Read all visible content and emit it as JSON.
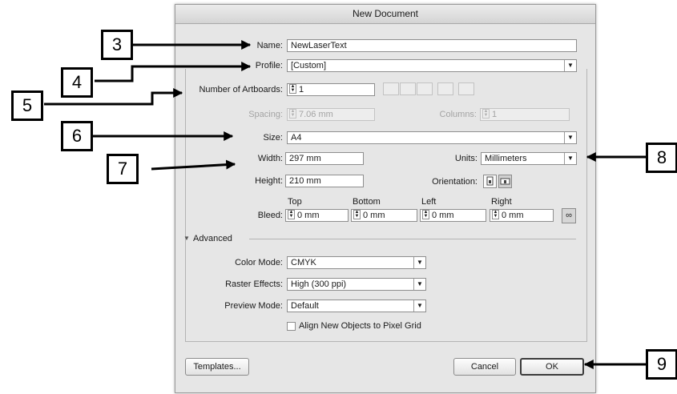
{
  "dialog": {
    "title": "New Document",
    "name": {
      "label": "Name:",
      "value": "NewLaserText"
    },
    "profile": {
      "label": "Profile:",
      "value": "[Custom]"
    },
    "artboards": {
      "label": "Number of Artboards:",
      "value": "1"
    },
    "spacing": {
      "label": "Spacing:",
      "value": "7.06 mm"
    },
    "columns": {
      "label": "Columns:",
      "value": "1"
    },
    "size": {
      "label": "Size:",
      "value": "A4"
    },
    "width": {
      "label": "Width:",
      "value": "297 mm"
    },
    "height": {
      "label": "Height:",
      "value": "210 mm"
    },
    "units": {
      "label": "Units:",
      "value": "Millimeters"
    },
    "orientation": {
      "label": "Orientation:",
      "selected": "landscape"
    },
    "bleed": {
      "label": "Bleed:",
      "top": {
        "label": "Top",
        "value": "0 mm"
      },
      "bottom": {
        "label": "Bottom",
        "value": "0 mm"
      },
      "left": {
        "label": "Left",
        "value": "0 mm"
      },
      "right": {
        "label": "Right",
        "value": "0 mm"
      }
    },
    "advanced": {
      "label": "Advanced",
      "color_mode": {
        "label": "Color Mode:",
        "value": "CMYK"
      },
      "raster_effects": {
        "label": "Raster Effects:",
        "value": "High (300 ppi)"
      },
      "preview_mode": {
        "label": "Preview Mode:",
        "value": "Default"
      },
      "align_pixel_grid": {
        "label": "Align New Objects to Pixel Grid",
        "checked": false
      }
    },
    "buttons": {
      "templates": "Templates...",
      "cancel": "Cancel",
      "ok": "OK"
    }
  },
  "callouts": [
    "3",
    "4",
    "5",
    "6",
    "7",
    "8",
    "9"
  ],
  "icons": {
    "spinner": "spinner-arrows-icon",
    "dropdown": "chevron-down-icon",
    "disclosure": "triangle-down-icon",
    "link": "link-icon"
  }
}
